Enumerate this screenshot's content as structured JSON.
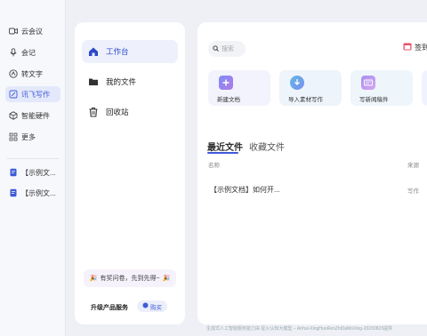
{
  "rail": {
    "items": [
      {
        "label": "云会议",
        "icon": "video-icon"
      },
      {
        "label": "会记",
        "icon": "mic-icon"
      },
      {
        "label": "转文字",
        "icon": "transcribe-icon"
      },
      {
        "label": "讯飞写作",
        "icon": "write-icon"
      },
      {
        "label": "智能硬件",
        "icon": "hardware-icon"
      },
      {
        "label": "更多",
        "icon": "grid-icon"
      }
    ],
    "docs": [
      {
        "label": "【示例文..."
      },
      {
        "label": "【示例文..."
      }
    ]
  },
  "nav": {
    "items": [
      {
        "label": "工作台"
      },
      {
        "label": "我的文件"
      },
      {
        "label": "回收站"
      }
    ],
    "promo": "有奖问卷，先到先得~",
    "upgrade": "升级产品服务",
    "buy": "购买"
  },
  "main": {
    "search_placeholder": "搜索",
    "signin": "签到",
    "cards": [
      {
        "label": "新建文档"
      },
      {
        "label": "导入素材写作"
      },
      {
        "label": "写新闻稿件"
      }
    ],
    "tabs": {
      "recent": "最近文件",
      "favorites": "收藏文件"
    },
    "columns": {
      "name": "名称",
      "source": "来源"
    },
    "rows": [
      {
        "name": "【示例文档】如何开...",
        "source": "写作"
      }
    ]
  },
  "footer": "生成式人工智能服务能力由 星火认知大模型 – Anhui-XingHuoRenZhiDaMoXing-20230823提供",
  "colors": {
    "accent": "#3f5bd8",
    "active_bg": "#e4e8fb"
  }
}
